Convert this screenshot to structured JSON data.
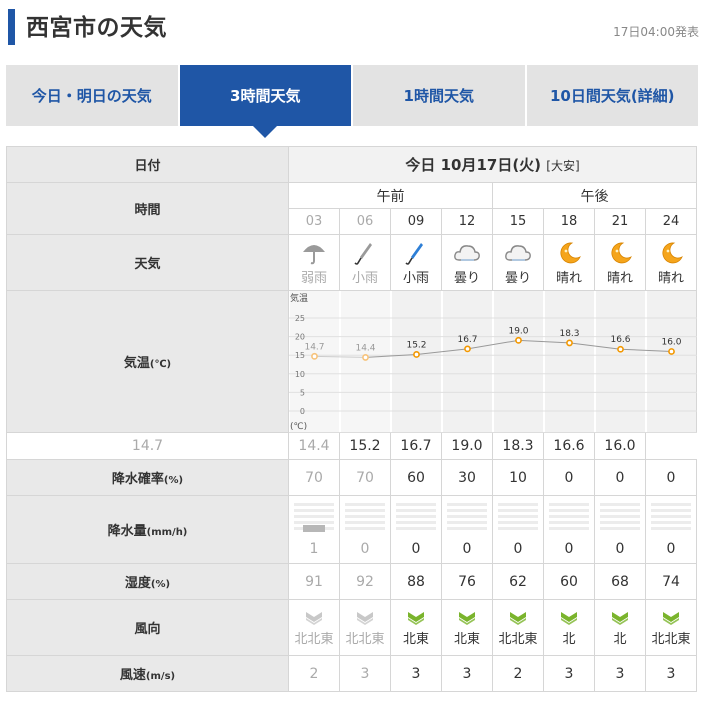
{
  "header": {
    "title": "西宮市の天気",
    "updated": "17日04:00発表"
  },
  "tabs": [
    {
      "label": "今日・明日の天気",
      "active": false
    },
    {
      "label": "3時間天気",
      "active": true
    },
    {
      "label": "1時間天気",
      "active": false
    },
    {
      "label": "10日間天気(詳細)",
      "active": false
    }
  ],
  "labels": {
    "date": "日付",
    "time": "時間",
    "weather": "天気",
    "temp": "気温",
    "temp_unit": "(℃)",
    "precip_prob": "降水確率",
    "precip_prob_unit": "(%)",
    "precip_amt": "降水量",
    "precip_amt_unit": "(mm/h)",
    "humidity": "湿度",
    "humidity_unit": "(%)",
    "wind_dir": "風向",
    "wind_speed": "風速",
    "wind_speed_unit": "(m/s)"
  },
  "day": {
    "date": "今日 10月17日(火)",
    "era": "[大安]",
    "am": "午前",
    "pm": "午後"
  },
  "hours": [
    {
      "time": "03",
      "weather": "弱雨",
      "icon": "umbrella",
      "temp": "14.7",
      "prob": "70",
      "amt": "1",
      "amt_value": 1,
      "hum": "91",
      "wdir": "北北東",
      "wspd": "2",
      "past": true
    },
    {
      "time": "06",
      "weather": "小雨",
      "icon": "umbrella-closed",
      "temp": "14.4",
      "prob": "70",
      "amt": "0",
      "amt_value": 0,
      "hum": "92",
      "wdir": "北北東",
      "wspd": "3",
      "past": true
    },
    {
      "time": "09",
      "weather": "小雨",
      "icon": "umbrella-closed-blue",
      "temp": "15.2",
      "prob": "60",
      "amt": "0",
      "amt_value": 0,
      "hum": "88",
      "wdir": "北東",
      "wspd": "3",
      "past": false
    },
    {
      "time": "12",
      "weather": "曇り",
      "icon": "cloud",
      "temp": "16.7",
      "prob": "30",
      "amt": "0",
      "amt_value": 0,
      "hum": "76",
      "wdir": "北東",
      "wspd": "3",
      "past": false
    },
    {
      "time": "15",
      "weather": "曇り",
      "icon": "cloud",
      "temp": "19.0",
      "prob": "10",
      "amt": "0",
      "amt_value": 0,
      "hum": "62",
      "wdir": "北北東",
      "wspd": "2",
      "past": false
    },
    {
      "time": "18",
      "weather": "晴れ",
      "icon": "moon",
      "temp": "18.3",
      "prob": "0",
      "amt": "0",
      "amt_value": 0,
      "hum": "60",
      "wdir": "北",
      "wspd": "3",
      "past": false
    },
    {
      "time": "21",
      "weather": "晴れ",
      "icon": "moon",
      "temp": "16.6",
      "prob": "0",
      "amt": "0",
      "amt_value": 0,
      "hum": "68",
      "wdir": "北",
      "wspd": "3",
      "past": false
    },
    {
      "time": "24",
      "weather": "晴れ",
      "icon": "moon",
      "temp": "16.0",
      "prob": "0",
      "amt": "0",
      "amt_value": 0,
      "hum": "74",
      "wdir": "北北東",
      "wspd": "3",
      "past": false
    }
  ],
  "colors": {
    "brand": "#1f56a6",
    "point": "#f39800",
    "wind_green": "#7ab42c",
    "moon": "#f5a51c"
  },
  "chart_data": {
    "type": "line",
    "title": "気温",
    "ylabel": "(℃)",
    "x": [
      "03",
      "06",
      "09",
      "12",
      "15",
      "18",
      "21",
      "24"
    ],
    "yticks": [
      "25",
      "20",
      "15",
      "10",
      "5",
      "0"
    ],
    "ylim": [
      0,
      25
    ],
    "series": [
      {
        "values": [
          14.7,
          14.4,
          15.2,
          16.7,
          19.0,
          18.3,
          16.6,
          16.0
        ]
      }
    ]
  }
}
